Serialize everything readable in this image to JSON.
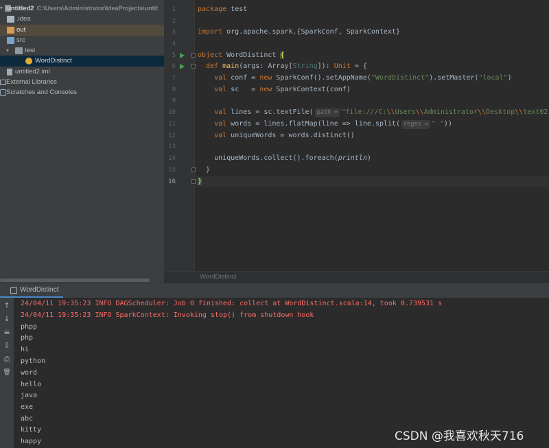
{
  "project_tree": {
    "root_label": "untitled2",
    "root_path": "C:\\Users\\Administrator\\IdeaProjects\\untit",
    "idea_label": ".idea",
    "out_label": "out",
    "src_label": "src",
    "test_label": "test",
    "class_label": "WordDistinct",
    "iml_label": "untitled2.iml",
    "ext_libs_label": "External Libraries",
    "scratches_label": "Scratches and Consoles"
  },
  "editor": {
    "line_numbers": [
      "1",
      "2",
      "3",
      "4",
      "5",
      "6",
      "7",
      "8",
      "9",
      "10",
      "11",
      "12",
      "13",
      "14",
      "15",
      "16"
    ],
    "breadcrumb": "WordDistinct",
    "code": {
      "l1_kw": "package",
      "l1_rest": " test",
      "l3_kw": "import",
      "l3_rest": " org.apache.spark.{SparkConf, SparkContext}",
      "l5_kw": "object",
      "l5_name": " WordDistinct ",
      "l5_brace": "{",
      "l6_kw": "  def",
      "l6_fn": " main",
      "l6_a": "(args: Array[",
      "l6_type": "String",
      "l6_b": "]): ",
      "l6_unit": "Unit",
      "l6_c": " = {",
      "l7_kw": "    val",
      "l7_a": " conf = ",
      "l7_new": "new",
      "l7_b": " SparkConf().setAppName(",
      "l7_s1": "\"WordDistinct\"",
      "l7_c": ").setMaster(",
      "l7_s2": "\"local\"",
      "l7_d": ")",
      "l8_kw": "    val",
      "l8_a": " sc   = ",
      "l8_new": "new",
      "l8_b": " SparkContext(conf)",
      "l10_kw": "    val",
      "l10_a": " lines = sc.textFile(",
      "l10_hint": "path =",
      "l10_s1": "\"file:///C:",
      "l10_e1": "\\\\",
      "l10_s2": "Users",
      "l10_e2": "\\\\",
      "l10_s3": "Administrator",
      "l10_e3": "\\\\",
      "l10_s4": "Desktop",
      "l10_e4": "\\\\",
      "l10_s5": "text02",
      "l11_kw": "    val",
      "l11_a": " words = lines.flatMap(line => line.split(",
      "l11_hint": "regex =",
      "l11_s": "\" \"",
      "l11_b": "))",
      "l12_kw": "    val",
      "l12_a": " uniqueWords = words.distinct()",
      "l14_a": "    uniqueWords.collect().foreach(",
      "l14_it": "println",
      "l14_b": ")",
      "l15": "  }",
      "l16": "}"
    }
  },
  "run_panel": {
    "tab_label": "WordDistinct",
    "side_buttons": [
      "↑",
      "↓",
      "≡",
      "⇩",
      "⎙",
      "🗑"
    ],
    "log_lines": [
      "24/04/11 19:35:23 INFO DAGScheduler: Job 0 finished: collect at WordDistinct.scala:14, took 0.739531 s",
      "24/04/11 19:35:23 INFO SparkContext: Invoking stop() from shutdown hook"
    ],
    "output_lines": [
      "phpp",
      "php",
      "hi",
      "python",
      "word",
      "hello",
      "java",
      "exe",
      "abc",
      "kitty",
      "happy"
    ]
  },
  "watermark": "CSDN @我喜欢秋天716",
  "colors": {
    "keyword": "#cc7832",
    "string": "#6a8759",
    "function": "#ffc66d",
    "error": "#ff6b68",
    "accent": "#4a88c7"
  }
}
